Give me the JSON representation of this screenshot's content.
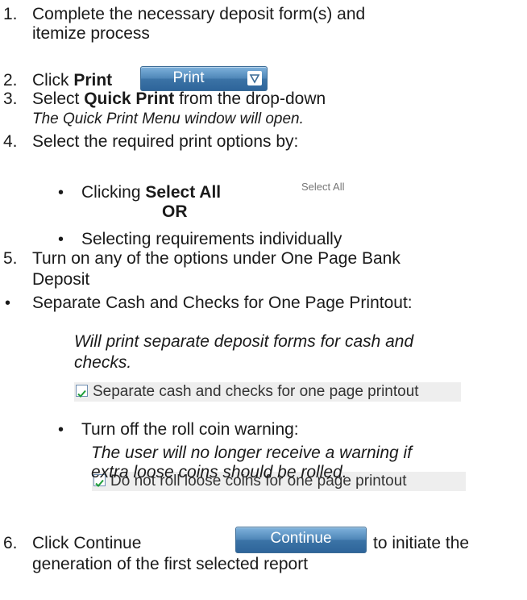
{
  "steps": {
    "s1": {
      "num": "1.",
      "line1": "Complete the necessary deposit form(s) and",
      "line2": "itemize process"
    },
    "s2": {
      "num": "2.",
      "pre": "Click ",
      "bold": "Print",
      "button": "Print"
    },
    "s3": {
      "num": "3.",
      "pre": "Select ",
      "bold": "Quick Print",
      "post": " from the drop-down",
      "note": "The Quick Print Menu window will open."
    },
    "s4": {
      "num": "4.",
      "text": "Select the required print options by:",
      "opt1_pre": "Clicking ",
      "opt1_bold": "Select All",
      "select_all_img": "Select All",
      "or": "OR",
      "opt2": "Selecting requirements individually"
    },
    "s5": {
      "num": "5.",
      "line1": "Turn on any of the options under One Page Bank",
      "line2": "Deposit"
    },
    "sep": {
      "text": "Separate Cash and Checks for One Page Printout:",
      "checkbox": "Separate cash and checks for one page printout",
      "note1": "Will print separate deposit forms for cash and",
      "note2": "checks."
    },
    "roll": {
      "text": "Turn off the roll coin warning:",
      "checkbox": "Do not roll loose coins for one page printout",
      "note1": "The user will no longer receive a warning if",
      "note2": "extra loose coins should be rolled."
    },
    "s6": {
      "num": "6.",
      "pre": "Click Continue",
      "button": "Continue",
      "post": "to initiate the",
      "line2": "generation of the first selected report"
    }
  },
  "colors": {
    "button": "#4f87b8",
    "checkmark": "#1f9e3a"
  }
}
